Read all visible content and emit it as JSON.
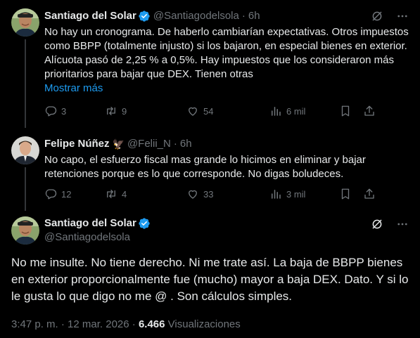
{
  "reply1": {
    "name": "Santiago del Solar",
    "handle": "@Santiagodelsola",
    "separator": "·",
    "time": "6h",
    "text": "No hay un cronograma. De haberlo cambiarían expectativas. Otros impuestos como BBPP (totalmente injusto) si los bajaron, en especial bienes en exterior. Alícuota pasó de 2,25 % a 0,5%. Hay impuestos que los consideraron más prioritarios para bajar que DEX. Tienen otras",
    "show_more": "Mostrar más",
    "replies": "3",
    "reposts": "9",
    "likes": "54",
    "views": "6 mil"
  },
  "reply2": {
    "name": "Felipe Núñez",
    "badge_emoji": "🦅",
    "handle": "@Felii_N",
    "separator": "·",
    "time": "6h",
    "text": "No capo, el esfuerzo fiscal mas grande lo hicimos en eliminar y bajar retenciones porque es lo que corresponde. No digas boludeces.",
    "replies": "12",
    "reposts": "4",
    "likes": "33",
    "views": "3 mil"
  },
  "main_post": {
    "name": "Santiago del Solar",
    "handle": "@Santiagodelsola",
    "text": "No me insulte. No tiene derecho. Ni me trate así. La baja de BBPP bienes en exterior proporcionalmente fue (mucho) mayor a baja DEX. Dato. Y si lo le gusta lo que digo no me @ . Son cálculos simples.",
    "timestamp": "3:47 p. m. · 12 mar. 2026 ·",
    "views_count": "6.466",
    "views_label": "Visualizaciones"
  },
  "icons": {
    "verified": "verified-badge-icon",
    "grok": "grok-icon",
    "more": "more-icon",
    "reply": "reply-icon",
    "repost": "repost-icon",
    "like": "like-icon",
    "views": "views-icon",
    "bookmark": "bookmark-icon",
    "share": "share-icon"
  },
  "colors": {
    "background": "#000000",
    "text": "#e7e9ea",
    "secondary": "#71767b",
    "accent": "#1d9bf0",
    "divider": "#2f3336"
  }
}
